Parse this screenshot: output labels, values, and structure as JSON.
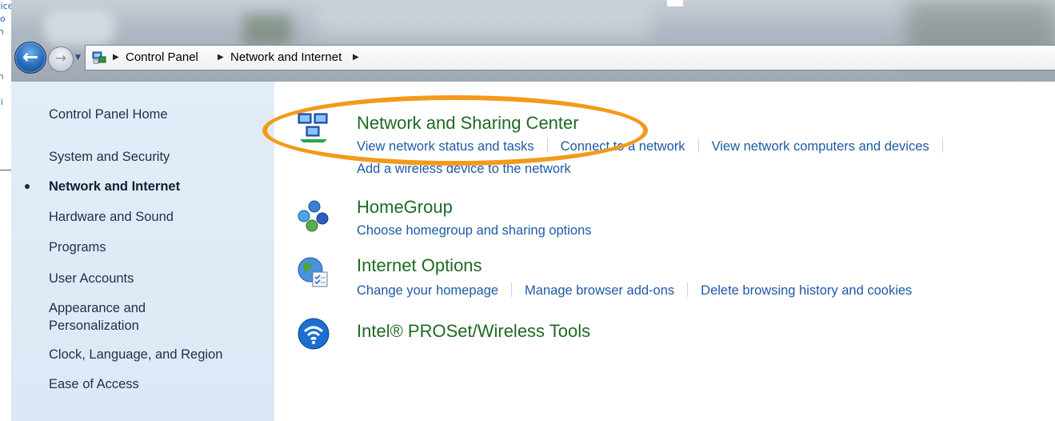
{
  "background_window": {
    "snippets": [
      "vice",
      "co",
      "m",
      "m",
      "a",
      "ai"
    ]
  },
  "navigation": {
    "back_label": "Back",
    "forward_label": "Forward",
    "breadcrumb": [
      "Control Panel",
      "Network and Internet"
    ]
  },
  "sidebar": {
    "items": [
      {
        "label": "Control Panel Home"
      },
      {
        "label": "System and Security"
      },
      {
        "label": "Network and Internet",
        "active": true
      },
      {
        "label": "Hardware and Sound"
      },
      {
        "label": "Programs"
      },
      {
        "label": "User Accounts"
      },
      {
        "label": "Appearance and Personalization",
        "line1": "Appearance and",
        "line2": "Personalization"
      },
      {
        "label": "Clock, Language, and Region"
      },
      {
        "label": "Ease of Access"
      }
    ]
  },
  "categories": [
    {
      "title": "Network and Sharing Center",
      "icon": "network-sharing-icon",
      "links": [
        "View network status and tasks",
        "Connect to a network",
        "View network computers and devices",
        "Add a wireless device to the network"
      ]
    },
    {
      "title": "HomeGroup",
      "icon": "homegroup-icon",
      "links": [
        "Choose homegroup and sharing options"
      ]
    },
    {
      "title": "Internet Options",
      "icon": "internet-options-icon",
      "links": [
        "Change your homepage",
        "Manage browser add-ons",
        "Delete browsing history and cookies"
      ]
    },
    {
      "title": "Intel® PROSet/Wireless Tools",
      "icon": "wireless-tools-icon",
      "links": []
    }
  ],
  "colors": {
    "category_title": "#1e6a22",
    "link": "#1d5aa7",
    "sidebar_bg": "#dce8f5",
    "highlight": "#f29a1a"
  }
}
